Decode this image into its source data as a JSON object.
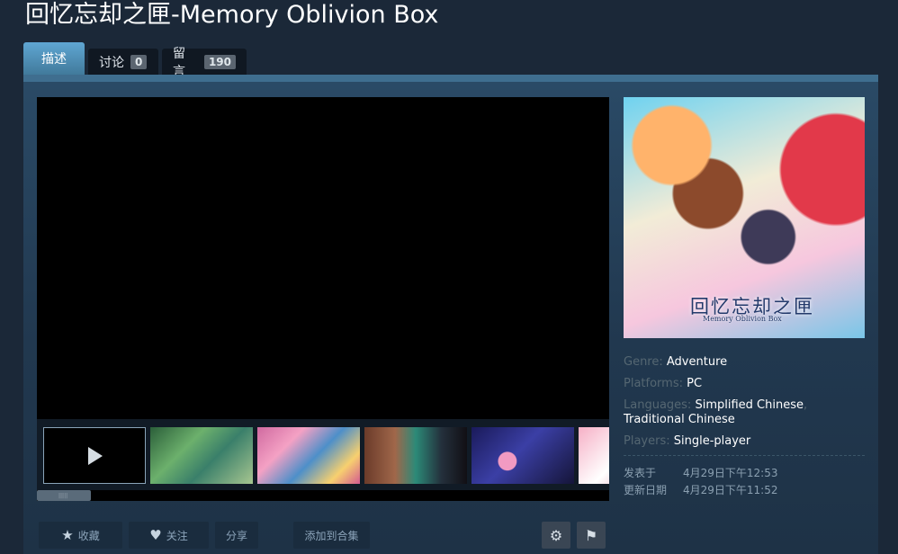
{
  "app": {
    "title": "回忆忘却之匣-Memory Oblivion Box"
  },
  "tabs": [
    {
      "label": "描述"
    },
    {
      "label": "讨论",
      "count": "0"
    },
    {
      "label": "留言",
      "count": "190"
    }
  ],
  "details": {
    "genre_label": "Genre:",
    "genre": "Adventure",
    "platforms_label": "Platforms:",
    "platforms": "PC",
    "languages_label": "Languages:",
    "languages_1": "Simplified Chinese",
    "languages_sep": ",",
    "languages_2": "Traditional Chinese",
    "players_label": "Players:",
    "players": "Single-player"
  },
  "dates": {
    "posted_label": "发表于",
    "posted": "4月29日下午12:53",
    "updated_label": "更新日期",
    "updated": "4月29日下午11:52"
  },
  "capsule": {
    "logo_text": "回忆忘却之匣",
    "logo_sub": "Memory Oblivion Box"
  },
  "actions": {
    "favorite": "收藏",
    "follow": "关注",
    "share": "分享",
    "add_collection": "添加到合集"
  },
  "icons": {
    "star": "star-icon",
    "heart": "heart-icon",
    "gear": "gear-icon",
    "flag": "flag-icon",
    "play": "play-icon"
  },
  "colors": {
    "accent": "#5fa6d3",
    "panel": "#2a4a66",
    "background": "#1b2838"
  }
}
